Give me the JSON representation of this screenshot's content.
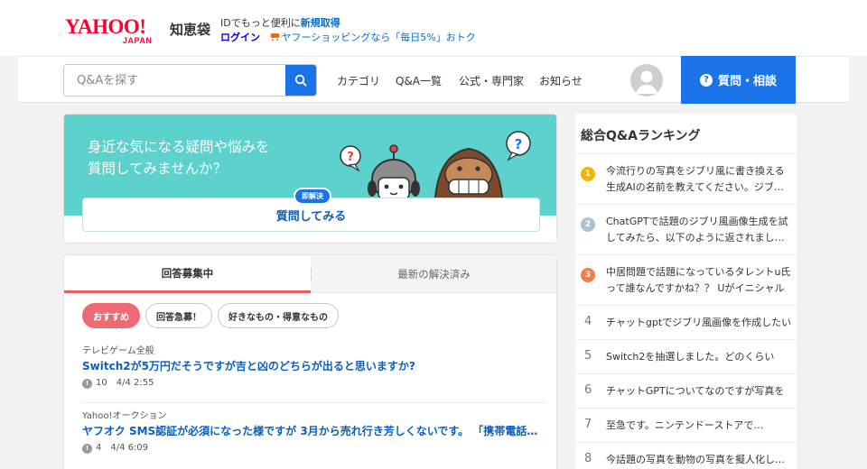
{
  "header": {
    "logo_yahoo": "YAHOO!",
    "logo_japan": "JAPAN",
    "service_name": "知恵袋",
    "promo_text": "IDでもっと便利に",
    "promo_link": "新規取得",
    "login_label": "ログイン",
    "shopping_promo": "ヤフーショッピングなら「毎日5%」おトク"
  },
  "nav": {
    "search_placeholder": "Q&Aを探す",
    "links": [
      "カテゴリ",
      "Q&A一覧",
      "公式・専門家",
      "お知らせ"
    ],
    "ask_button": "質問・相談"
  },
  "hero": {
    "line1": "身近な気になる疑問や悩みを",
    "line2": "質問してみませんか？",
    "badge": "即解決",
    "button": "質問してみる"
  },
  "feed": {
    "tabs": [
      "回答募集中",
      "最新の解決済み"
    ],
    "chips": [
      "おすすめ",
      "回答急募！",
      "好きなもの・得意なもの"
    ],
    "questions": [
      {
        "category": "テレビゲーム全般",
        "title": "Switch2が5万円だそうですが吉と凶のどちらが出ると思いますか?",
        "answers": "10",
        "date": "4/4 2:55"
      },
      {
        "category": "Yahoo!オークション",
        "title": "ヤフオク SMS認証が必須になった様ですが 3月から売れ行き芳しくないです。 「携帯電話番号の登録",
        "answers": "4",
        "date": "4/4 6:09"
      }
    ]
  },
  "ranking": {
    "title": "総合Q&Aランキング",
    "items": [
      {
        "rank": "1",
        "text": "今流行りの写真をジブリ風に書き換える生成AIの名前を教えてください。ジブリ風の写真"
      },
      {
        "rank": "2",
        "text": "ChatGPTで話題のジブリ風画像生成を試してみたら、以下のように返されました。これ"
      },
      {
        "rank": "3",
        "text": "中居問題で話題になっているタレントu氏って誰なんですかね？？ Uがイニシャル"
      },
      {
        "rank": "4",
        "text": "チャットgptでジブリ風画像を作成したい"
      },
      {
        "rank": "5",
        "text": "Switch2を抽選しました。どのくらい"
      },
      {
        "rank": "6",
        "text": "チャットGPTについてなのですが写真を"
      },
      {
        "rank": "7",
        "text": "至急です。ニンテンドーストアで…"
      },
      {
        "rank": "8",
        "text": "今話題の写真を動物の写真を擬人化したい"
      }
    ],
    "colors": [
      "#f5b400",
      "#a9c2d8",
      "#f07d4a"
    ]
  }
}
